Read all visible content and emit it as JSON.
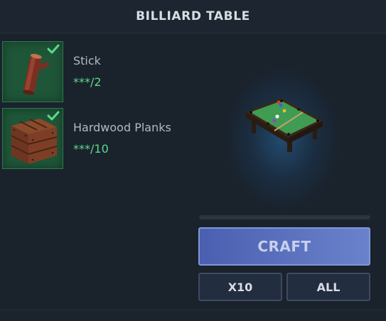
{
  "header": {
    "title": "BILLIARD TABLE"
  },
  "ingredients": [
    {
      "name": "Stick",
      "count": "***/2",
      "icon": "stick-icon",
      "owned": true
    },
    {
      "name": "Hardwood Planks",
      "count": "***/10",
      "icon": "hardwood-planks-icon",
      "owned": true
    }
  ],
  "preview": {
    "icon": "billiard-table-icon"
  },
  "actions": {
    "craft_label": "CRAFT",
    "x10_label": "X10",
    "all_label": "ALL"
  },
  "colors": {
    "slot_bg": "#1f5638",
    "count_text": "#5ed98c",
    "craft_button": "#5a70c0",
    "check": "#5ed98c"
  }
}
